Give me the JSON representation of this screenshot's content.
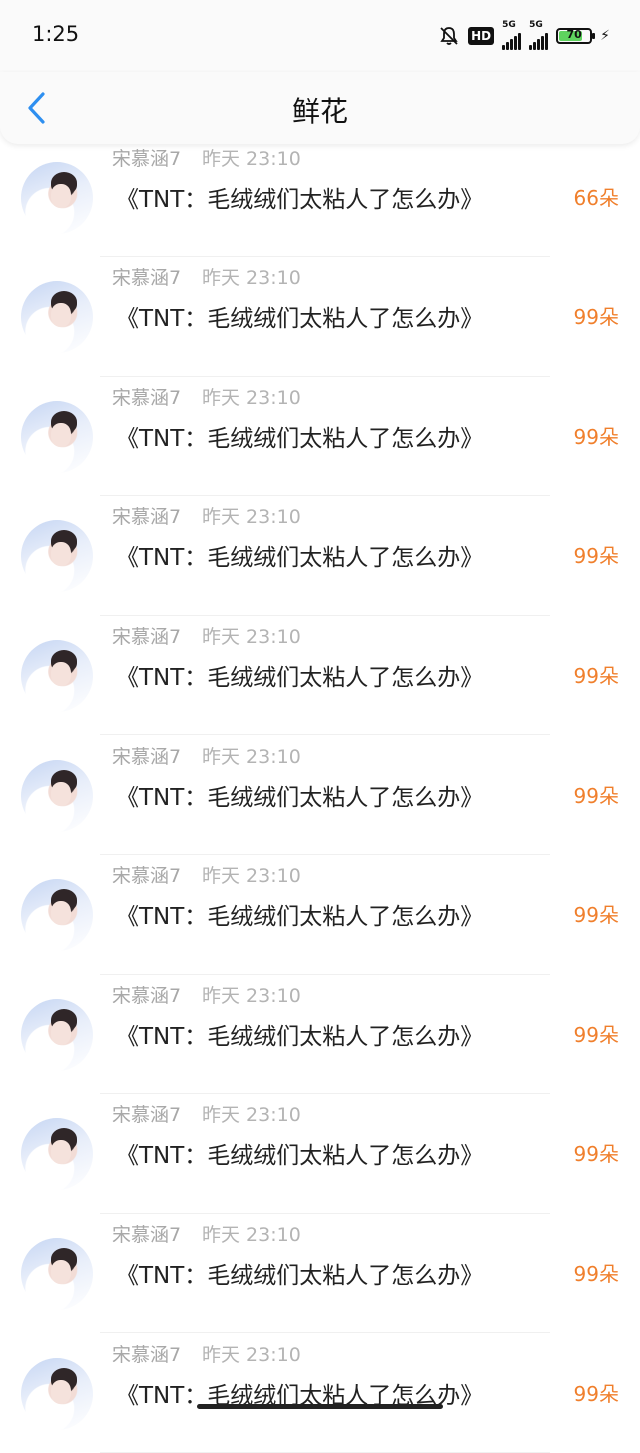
{
  "status_bar": {
    "time": "1:25",
    "hd_label": "HD",
    "network_1": "5G",
    "network_2": "5G",
    "battery_level": "70"
  },
  "header": {
    "title": "鲜花"
  },
  "records": [
    {
      "user": "宋慕涵7",
      "time": "昨天 23:10",
      "content": "《TNT：毛绒绒们太粘人了怎么办》",
      "count": "66朵"
    },
    {
      "user": "宋慕涵7",
      "time": "昨天 23:10",
      "content": "《TNT：毛绒绒们太粘人了怎么办》",
      "count": "99朵"
    },
    {
      "user": "宋慕涵7",
      "time": "昨天 23:10",
      "content": "《TNT：毛绒绒们太粘人了怎么办》",
      "count": "99朵"
    },
    {
      "user": "宋慕涵7",
      "time": "昨天 23:10",
      "content": "《TNT：毛绒绒们太粘人了怎么办》",
      "count": "99朵"
    },
    {
      "user": "宋慕涵7",
      "time": "昨天 23:10",
      "content": "《TNT：毛绒绒们太粘人了怎么办》",
      "count": "99朵"
    },
    {
      "user": "宋慕涵7",
      "time": "昨天 23:10",
      "content": "《TNT：毛绒绒们太粘人了怎么办》",
      "count": "99朵"
    },
    {
      "user": "宋慕涵7",
      "time": "昨天 23:10",
      "content": "《TNT：毛绒绒们太粘人了怎么办》",
      "count": "99朵"
    },
    {
      "user": "宋慕涵7",
      "time": "昨天 23:10",
      "content": "《TNT：毛绒绒们太粘人了怎么办》",
      "count": "99朵"
    },
    {
      "user": "宋慕涵7",
      "time": "昨天 23:10",
      "content": "《TNT：毛绒绒们太粘人了怎么办》",
      "count": "99朵"
    },
    {
      "user": "宋慕涵7",
      "time": "昨天 23:10",
      "content": "《TNT：毛绒绒们太粘人了怎么办》",
      "count": "99朵"
    },
    {
      "user": "宋慕涵7",
      "time": "昨天 23:10",
      "content": "《TNT：毛绒绒们太粘人了怎么办》",
      "count": "99朵"
    }
  ],
  "colors": {
    "accent_back": "#2e8ff0",
    "count_orange": "#f07f2c"
  }
}
